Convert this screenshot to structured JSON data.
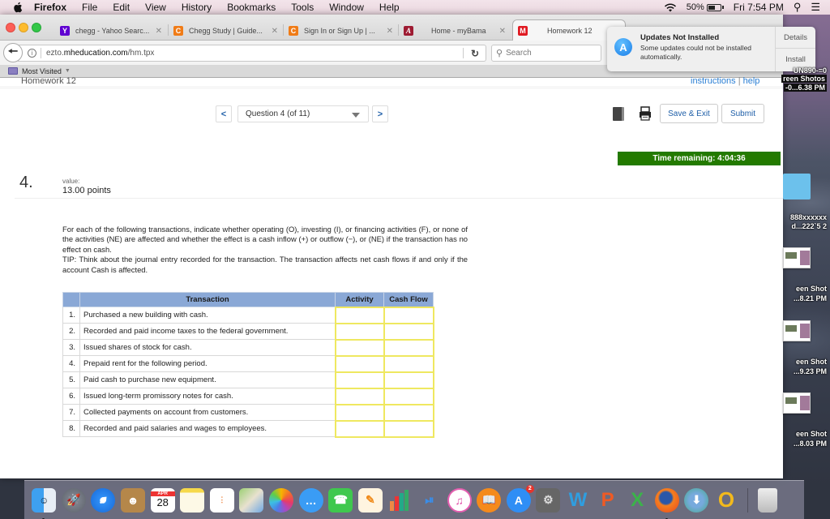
{
  "menubar": {
    "app_name": "Firefox",
    "items": [
      "File",
      "Edit",
      "View",
      "History",
      "Bookmarks",
      "Tools",
      "Window",
      "Help"
    ],
    "battery": "50%",
    "clock": "Fri 7:54 PM"
  },
  "tabs": [
    {
      "title": "chegg - Yahoo Searc...",
      "favicon": "Y",
      "color": "#5f01d1",
      "active": false
    },
    {
      "title": "Chegg Study | Guide...",
      "favicon": "C",
      "color": "#f07b16",
      "active": false
    },
    {
      "title": "Sign In or Sign Up | ...",
      "favicon": "C",
      "color": "#f07b16",
      "active": false
    },
    {
      "title": "Home - myBama",
      "favicon": "A",
      "color": "#9e1b32",
      "active": false
    },
    {
      "title": "Homework 12",
      "favicon": "M",
      "color": "#e01a22",
      "active": true
    }
  ],
  "navbar": {
    "url_prefix": "ezto.",
    "url_domain": "mheducation.com",
    "url_path": "/hm.tpx",
    "search_placeholder": "Search"
  },
  "bookmarks": {
    "most_visited": "Most Visited"
  },
  "notification": {
    "title": "Updates Not Installed",
    "body": "Some updates could not be installed automatically.",
    "details_label": "Details",
    "install_label": "Install"
  },
  "page": {
    "homework_title": "Homework 12",
    "instructions_link": "instructions",
    "links_sep": " | ",
    "help_link": "help",
    "question_select": "Question 4 (of 11)",
    "prev_label": "<",
    "next_label": ">",
    "save_exit_label": "Save & Exit",
    "submit_label": "Submit",
    "timer": "Time remaining: 4:04:36",
    "question_number": "4.",
    "value_label": "value:",
    "value_points": "13.00 points",
    "prompt_p1": "For each of the following transactions, indicate whether operating (O), investing (I), or financing activities (F), or none of the activities (NE) are affected and whether the effect is a cash inflow (+) or outflow (−), or (NE) if the transaction has no effect on cash.",
    "prompt_p2": "TIP: Think about the journal entry recorded for the transaction. The transaction affects net cash flows if and only if the account Cash is affected."
  },
  "table": {
    "headers": {
      "transaction": "Transaction",
      "activity": "Activity",
      "cash_flow": "Cash Flow"
    },
    "rows": [
      {
        "num": "1.",
        "desc": "Purchased a new building with cash.",
        "activity": "",
        "cash_flow": ""
      },
      {
        "num": "2.",
        "desc": "Recorded and paid income taxes to the federal government.",
        "activity": "",
        "cash_flow": ""
      },
      {
        "num": "3.",
        "desc": "Issued shares of stock for cash.",
        "activity": "",
        "cash_flow": ""
      },
      {
        "num": "4.",
        "desc": "Prepaid rent for the following period.",
        "activity": "",
        "cash_flow": ""
      },
      {
        "num": "5.",
        "desc": "Paid cash to purchase new equipment.",
        "activity": "",
        "cash_flow": ""
      },
      {
        "num": "6.",
        "desc": "Issued long-term promissory notes for cash.",
        "activity": "",
        "cash_flow": ""
      },
      {
        "num": "7.",
        "desc": "Collected payments on account from customers.",
        "activity": "",
        "cash_flow": ""
      },
      {
        "num": "8.",
        "desc": "Recorded and paid salaries and wages to employees.",
        "activity": "",
        "cash_flow": ""
      }
    ]
  },
  "desktop": {
    "items": [
      {
        "line1": "UN890-=0",
        "line2": "reen Shotos",
        "line3": "-0...6.38 PM"
      },
      {
        "line1": "888xxxxxx",
        "line2": "d...222`5 2"
      },
      {
        "line1": "een Shot",
        "line2": "...8.21 PM"
      },
      {
        "line1": "een Shot",
        "line2": "...9.23 PM"
      },
      {
        "line1": "een Shot",
        "line2": "...8.03 PM"
      }
    ]
  },
  "dock": {
    "calendar_month": "APR",
    "calendar_day": "28",
    "app_store_badge": "2",
    "apps": [
      "Finder",
      "Launchpad",
      "Safari",
      "Contacts",
      "Calendar",
      "Notes",
      "Reminders",
      "Maps",
      "Photos",
      "Messages",
      "FaceTime",
      "Pages",
      "Numbers",
      "Keynote",
      "iTunes",
      "iBooks",
      "App Store",
      "System Preferences",
      "Word",
      "PowerPoint",
      "Excel",
      "Firefox",
      "Downloader",
      "Outlook",
      "Trash"
    ]
  }
}
